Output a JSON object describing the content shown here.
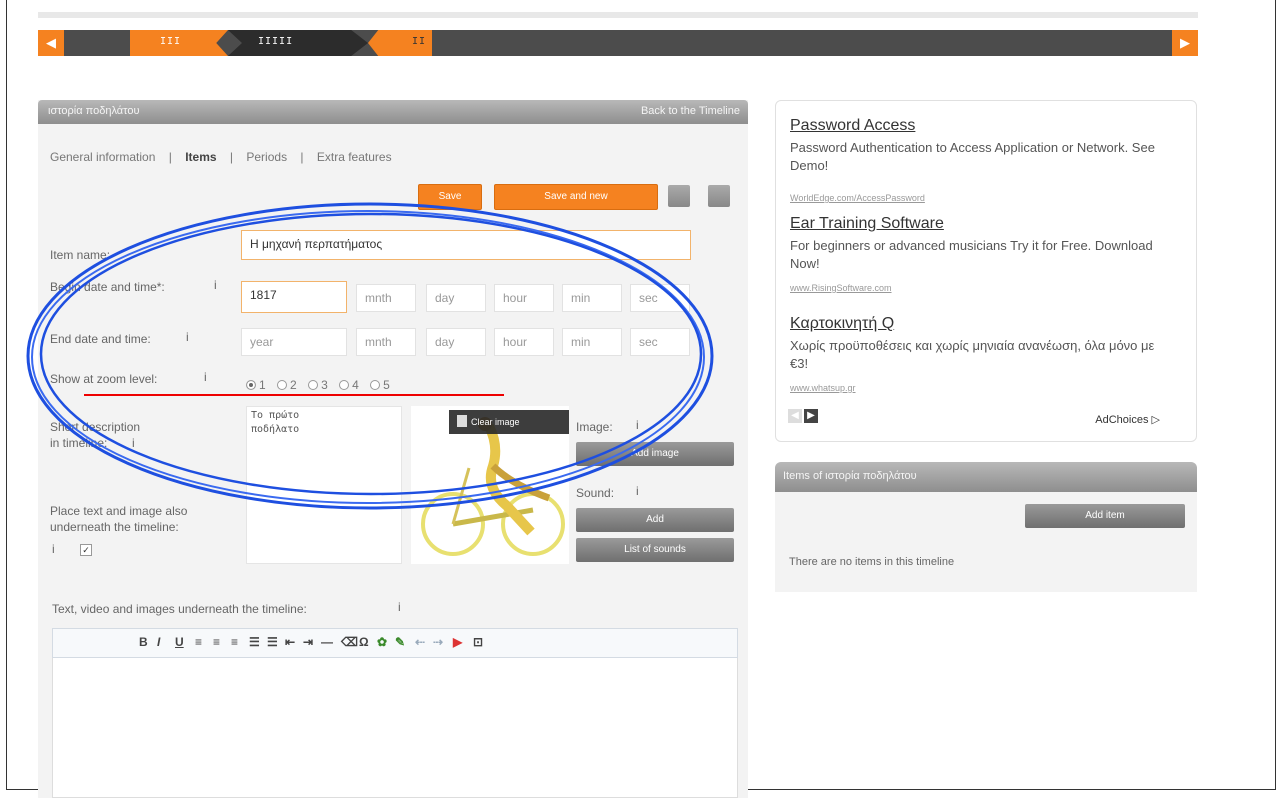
{
  "timeline": {
    "prev_icon": "◀",
    "next_icon": "▶",
    "ticks_a": "III",
    "ticks_b": "IIIII",
    "ticks_c": "II"
  },
  "panel": {
    "title": "ιστορία ποδηλάτου",
    "back_link": "Back to the Timeline"
  },
  "tabs": [
    "General information",
    "|",
    "Items",
    "|",
    "Periods",
    "|",
    "Extra features"
  ],
  "buttons": {
    "save": "Save",
    "save_new": "Save and new",
    "add_image": "Add image",
    "add_sound": "Add",
    "list_sounds": "List of sounds",
    "clear_image": "Clear image",
    "add_item": "Add item"
  },
  "form": {
    "item_name_label": "Item name:",
    "item_name_value": "Η μηχανή περπατήματος",
    "begin_label": "Begin date and time*:",
    "begin_year": "1817",
    "end_label": "End date and time:",
    "ph_year": "year",
    "ph_mnth": "mnth",
    "ph_day": "day",
    "ph_hour": "hour",
    "ph_min": "min",
    "ph_sec": "sec",
    "zoom_label": "Show at zoom level:",
    "zoom_levels": [
      "1",
      "2",
      "3",
      "4",
      "5"
    ],
    "short_desc_label_1": "Short description",
    "short_desc_label_2": "in timeline:",
    "short_desc_value": "Το πρώτο\nποδήλατο",
    "image_label": "Image:",
    "sound_label": "Sound:",
    "place_label_1": "Place text and image also",
    "place_label_2": "underneath the timeline:",
    "info": "i",
    "checked": "✓",
    "editor_label": "Text, video and images underneath the timeline:"
  },
  "editor_tools": [
    "B",
    "I",
    "U",
    "≡",
    "≡",
    "≡",
    "☰",
    "☰",
    "⇤",
    "⇥",
    "—",
    "⌫",
    "Ω",
    "✿",
    "✎",
    "⇠",
    "⇢",
    "▶",
    "⊡"
  ],
  "ads": [
    {
      "title": "Password Access",
      "text": "Password Authentication to Access Application or Network. See Demo!",
      "url": "WorldEdge.com/AccessPassword"
    },
    {
      "title": "Ear Training Software",
      "text": "For beginners or advanced musicians Try it for Free. Download Now!",
      "url": "www.RisingSoftware.com"
    },
    {
      "title": "Καρτοκινητή Q",
      "text": "Χωρίς προϋποθέσεις και χωρίς μηνιαία ανανέωση, όλα μόνο με €3!",
      "url": "www.whatsup.gr"
    }
  ],
  "ad_nav": {
    "prev": "◀",
    "next": "▶",
    "adchoices": "AdChoices ▷"
  },
  "items_panel": {
    "title": "Items of ιστορία ποδηλάτου",
    "empty_text": "There are no items in this timeline"
  },
  "colors": {
    "accent": "#f58220",
    "strip": "#4c4c4c",
    "annotation_blue": "#1e4fe0",
    "annotation_red": "#e00000"
  }
}
